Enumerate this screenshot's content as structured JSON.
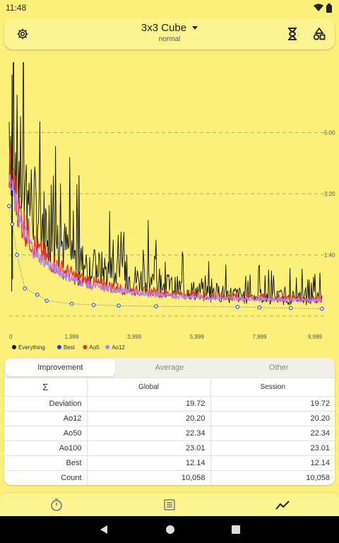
{
  "status_bar": {
    "time": "11:48"
  },
  "app_bar": {
    "title": "3x3 Cube",
    "subtitle": "normal"
  },
  "colors": {
    "background": "#fbf17a",
    "everything": "#111111",
    "best": "#1e3bd6",
    "ao5": "#e8302d",
    "ao12": "#b484f5",
    "grid": "#7a7450"
  },
  "chart_data": {
    "type": "line",
    "x_ticks": [
      "0",
      "1,999",
      "3,999",
      "5,999",
      "7,999",
      "9,999"
    ],
    "y_ticks": [
      "1:40",
      "3:20",
      "5:00"
    ],
    "xlim": [
      0,
      9999
    ],
    "ylim": [
      0,
      400
    ],
    "series": [
      {
        "name": "Everything",
        "values": [
          320,
          215,
          170,
          140,
          115,
          90,
          80,
          75,
          68,
          62,
          58,
          52,
          48,
          44,
          40,
          38,
          36,
          34,
          33,
          32,
          31,
          30,
          30,
          29
        ]
      },
      {
        "name": "Best",
        "x": [
          0,
          100,
          250,
          500,
          900,
          1200,
          2000,
          2700,
          3500,
          4700,
          7300,
          8000,
          9000,
          9999
        ],
        "values": [
          180,
          150,
          100,
          45,
          35,
          25,
          20,
          18,
          17,
          16,
          15,
          14,
          13,
          12
        ]
      },
      {
        "name": "Ao5",
        "values": [
          240,
          150,
          110,
          90,
          75,
          62,
          55,
          50,
          46,
          42,
          40,
          38,
          36,
          35,
          34,
          33,
          32,
          31,
          31,
          30,
          30,
          29,
          28,
          28
        ]
      },
      {
        "name": "Ao12",
        "values": [
          220,
          140,
          100,
          82,
          68,
          57,
          50,
          45,
          42,
          39,
          37,
          35,
          33,
          32,
          31,
          30,
          29,
          29,
          28,
          28,
          27,
          27,
          26,
          26
        ]
      }
    ],
    "legend_position": "bottom-left",
    "grid": true
  },
  "stats": {
    "tabs": [
      {
        "label": "Improvement",
        "active": true
      },
      {
        "label": "Average",
        "active": false
      },
      {
        "label": "Other",
        "active": false
      }
    ],
    "header": {
      "sigma": "Σ",
      "global": "Global",
      "session": "Session"
    },
    "rows": [
      {
        "label": "Deviation",
        "global": "19.72",
        "session": "19.72"
      },
      {
        "label": "Ao12",
        "global": "20.20",
        "session": "20.20"
      },
      {
        "label": "Ao50",
        "global": "22.34",
        "session": "22.34"
      },
      {
        "label": "Ao100",
        "global": "23.01",
        "session": "23.01"
      },
      {
        "label": "Best",
        "global": "12.14",
        "session": "12.14"
      },
      {
        "label": "Count",
        "global": "10,058",
        "session": "10,058"
      }
    ]
  },
  "bottom_nav": {
    "items": [
      "timer-icon",
      "list-icon",
      "chart-icon"
    ],
    "active": 2
  }
}
